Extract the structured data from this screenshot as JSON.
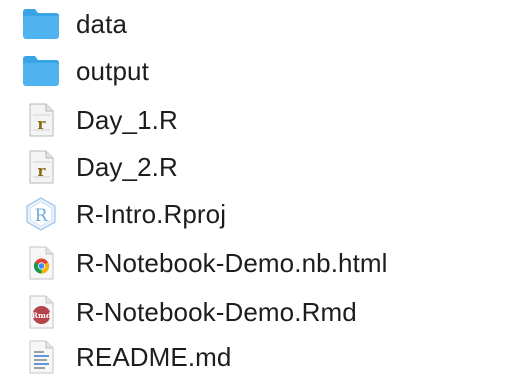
{
  "files": [
    {
      "name": "data",
      "icon": "folder-icon",
      "kind": "folder"
    },
    {
      "name": "output",
      "icon": "folder-icon",
      "kind": "folder"
    },
    {
      "name": "Day_1.R",
      "icon": "r-script-icon",
      "kind": "r-script"
    },
    {
      "name": "Day_2.R",
      "icon": "r-script-icon",
      "kind": "r-script"
    },
    {
      "name": "R-Intro.Rproj",
      "icon": "rproj-icon",
      "kind": "rproj"
    },
    {
      "name": "R-Notebook-Demo.nb.html",
      "icon": "chrome-html-icon",
      "kind": "html"
    },
    {
      "name": "R-Notebook-Demo.Rmd",
      "icon": "rmd-icon",
      "kind": "rmd"
    },
    {
      "name": "README.md",
      "icon": "markdown-doc-icon",
      "kind": "markdown"
    }
  ],
  "icon_labels": {
    "r_script": "r",
    "rproj": "R",
    "rmd": "Rmd"
  },
  "colors": {
    "folder": "#4fb3ef",
    "folder_tab": "#3aa3e3",
    "text": "#1d1d1f",
    "rmd_badge": "#b5434c",
    "rproj": "#6fa8dc",
    "r_script_letter": "#8a6d12"
  }
}
